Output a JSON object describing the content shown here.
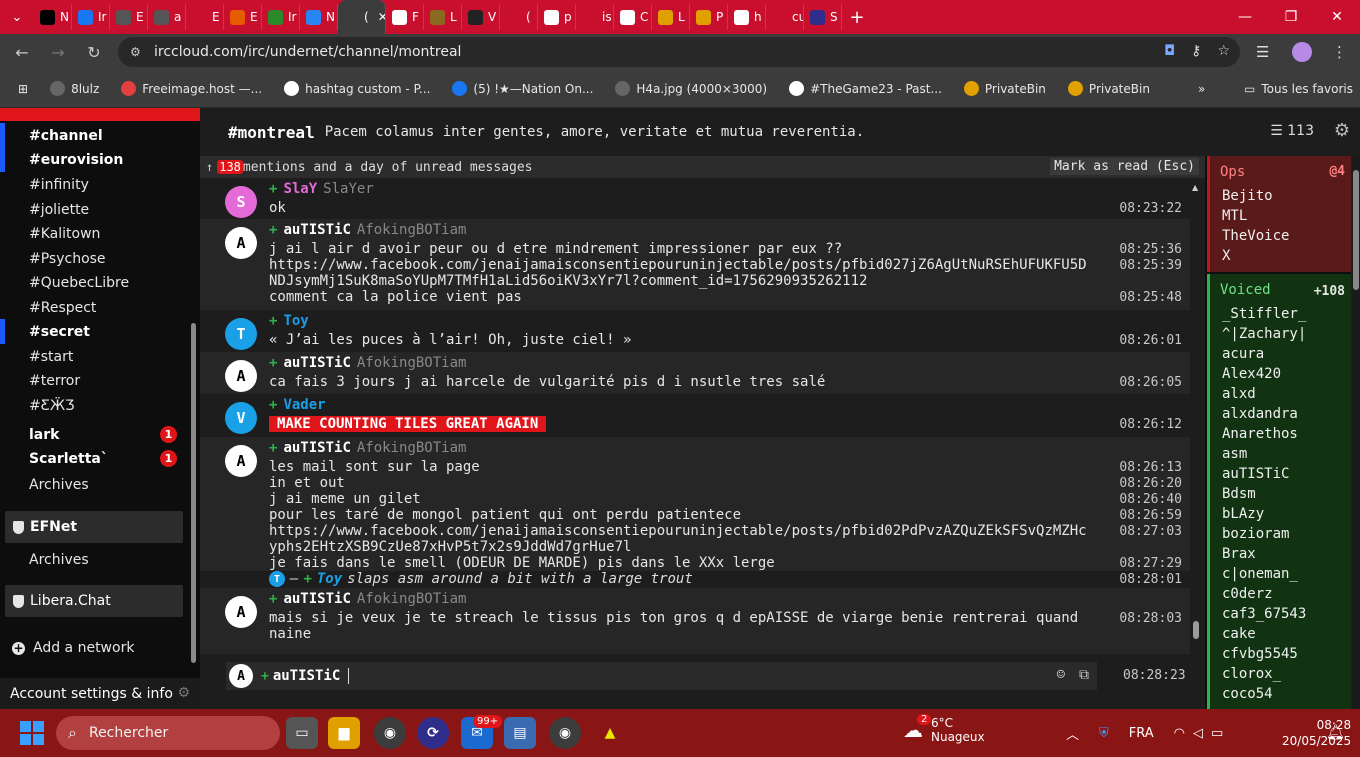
{
  "browser": {
    "tabs": [
      {
        "icon": "x",
        "label": "N",
        "color": "#000000"
      },
      {
        "icon": "f",
        "label": "Ir",
        "color": "#1877f2"
      },
      {
        "icon": "globe",
        "label": "E",
        "color": "#555555"
      },
      {
        "icon": "globe",
        "label": "a",
        "color": "#555555"
      },
      {
        "icon": "spider",
        "label": "E",
        "color": "#c8102e"
      },
      {
        "icon": "gear",
        "label": "E",
        "color": "#e65c00"
      },
      {
        "icon": "earth",
        "label": "Ir",
        "color": "#2a8a2a"
      },
      {
        "icon": "vk",
        "label": "N",
        "color": "#2787f5"
      },
      {
        "icon": "irccloud",
        "label": "(",
        "color": "#3c3c3c"
      },
      {
        "icon": "f",
        "label": "F",
        "color": "#ffffff"
      },
      {
        "icon": "pic",
        "label": "L",
        "color": "#8a6a20"
      },
      {
        "icon": "eyes",
        "label": "V",
        "color": "#222222"
      },
      {
        "icon": "leaf",
        "label": "(",
        "color": "#c8102e"
      },
      {
        "icon": "grid",
        "label": "p",
        "color": "#ffffff"
      },
      {
        "icon": "is",
        "label": "is",
        "color": "#c8102e"
      },
      {
        "icon": "io",
        "label": "C",
        "color": "#ffffff"
      },
      {
        "icon": "hat",
        "label": "L",
        "color": "#e0a000"
      },
      {
        "icon": "hex",
        "label": "P",
        "color": "#e0a000"
      },
      {
        "icon": "grid",
        "label": "h",
        "color": "#ffffff"
      },
      {
        "icon": "cu",
        "label": "cu",
        "color": "#c8102e"
      },
      {
        "icon": "s",
        "label": "S",
        "color": "#2e2e8a"
      }
    ],
    "tab_close": "✕",
    "new_tab": "+",
    "url": "irccloud.com/irc/undernet/channel/montreal",
    "bookmarks": [
      {
        "label": "8lulz",
        "color": "#666666"
      },
      {
        "label": "Freeimage.host —...",
        "color": "#e04040"
      },
      {
        "label": "hashtag custom - P...",
        "color": "#ffffff"
      },
      {
        "label": "(5) !★—Nation On...",
        "color": "#1877f2"
      },
      {
        "label": "H4a.jpg (4000×3000)",
        "color": "#666666"
      },
      {
        "label": "#TheGame23 - Past...",
        "color": "#ffffff"
      },
      {
        "label": "PrivateBin",
        "color": "#e0a000"
      },
      {
        "label": "PrivateBin",
        "color": "#e0a000"
      }
    ],
    "all_bookmarks": "Tous les favoris"
  },
  "sidebar": {
    "channels": [
      {
        "name": "#channel",
        "bold": true,
        "unread": false,
        "badge": ""
      },
      {
        "name": "#eurovision",
        "bold": true,
        "unread": false,
        "badge": ""
      },
      {
        "name": "#infinity",
        "bold": false,
        "unread": false,
        "badge": ""
      },
      {
        "name": "#joliette",
        "bold": false,
        "unread": false,
        "badge": ""
      },
      {
        "name": "#Kalitown",
        "bold": false,
        "unread": false,
        "badge": ""
      },
      {
        "name": "#Psychose",
        "bold": false,
        "unread": false,
        "badge": ""
      },
      {
        "name": "#QuebecLibre",
        "bold": false,
        "unread": false,
        "badge": ""
      },
      {
        "name": "#Respect",
        "bold": false,
        "unread": false,
        "badge": ""
      },
      {
        "name": "#secret",
        "bold": true,
        "unread": true,
        "badge": ""
      },
      {
        "name": "#start",
        "bold": false,
        "unread": false,
        "badge": ""
      },
      {
        "name": "#terror",
        "bold": false,
        "unread": false,
        "badge": ""
      },
      {
        "name": "#ƸӜƷ",
        "bold": false,
        "unread": false,
        "badge": ""
      },
      {
        "name": "lark",
        "bold": true,
        "unread": false,
        "badge": "1"
      },
      {
        "name": "Scarletta`",
        "bold": true,
        "unread": false,
        "badge": "1"
      },
      {
        "name": "Archives",
        "bold": false,
        "unread": false,
        "badge": ""
      }
    ],
    "networks": [
      "EFNet",
      "Libera.Chat"
    ],
    "efnet_archives": "Archives",
    "add_network": "Add a network",
    "account": "Account settings & info"
  },
  "header": {
    "channel": "#montreal",
    "topic": "Pacem colamus inter gentes, amore, veritate et mutua reverentia.",
    "member_count": "113"
  },
  "unread": {
    "count": "138",
    "text": "mentions and a day of unread messages",
    "mark_read": "Mark as read (Esc)"
  },
  "messages": [
    {
      "nick": "SlaY",
      "realname": "SlaYer",
      "avatar": "S",
      "avatar_color": "#e46ad8",
      "nick_color": "#e46ad8",
      "alt": false,
      "lines": [
        {
          "text": "ok",
          "time": "08:23:22"
        }
      ]
    },
    {
      "nick": "auTISTiC",
      "realname": "AfokingBOTiam",
      "avatar": "A",
      "avatar_color": "#ffffff",
      "nick_color": "#ffffff",
      "alt": true,
      "lines": [
        {
          "text": "j ai l air d avoir peur ou d etre mindrement impressioner par eux ??",
          "time": "08:25:36"
        },
        {
          "text": "https://www.facebook.com/jenaijamaisconsentiepouruninjectable/posts/pfbid027jZ6AgUtNuRSEhUFUKFU5D",
          "time": "08:25:39"
        },
        {
          "text": "NDJsymMj1SuK8maSoYUpM7TMfH1aLid56oiKV3xYr7l?comment_id=1756290935262112",
          "time": ""
        },
        {
          "text": "comment ca la police vient pas",
          "time": "08:25:48"
        }
      ]
    },
    {
      "nick": "Toy",
      "realname": "",
      "avatar": "T",
      "avatar_color": "#1aa0e6",
      "nick_color": "#1aa0e6",
      "alt": false,
      "lines": [
        {
          "text": "« J’ai les puces à l’air! Oh, juste ciel! »",
          "time": "08:26:01"
        }
      ]
    },
    {
      "nick": "auTISTiC",
      "realname": "AfokingBOTiam",
      "avatar": "A",
      "avatar_color": "#ffffff",
      "nick_color": "#ffffff",
      "alt": true,
      "lines": [
        {
          "text": "ca fais 3 jours j ai harcele de vulgarité pis d i nsutle tres salé",
          "time": "08:26:05"
        }
      ]
    },
    {
      "nick": "Vader",
      "realname": "",
      "avatar": "V",
      "avatar_color": "#1aa0e6",
      "nick_color": "#1aa0e6",
      "alt": false,
      "lines": [
        {
          "text": "MAKE COUNTING TILES GREAT AGAIN",
          "time": "08:26:12",
          "highlight": true
        }
      ]
    },
    {
      "nick": "auTISTiC",
      "realname": "AfokingBOTiam",
      "avatar": "A",
      "avatar_color": "#ffffff",
      "nick_color": "#ffffff",
      "alt": true,
      "lines": [
        {
          "text": "les mail sont sur la page",
          "time": "08:26:13"
        },
        {
          "text": "in et out",
          "time": "08:26:20"
        },
        {
          "text": "j ai meme un gilet",
          "time": "08:26:40"
        },
        {
          "text": "pour les taré de mongol patient qui ont perdu patientece",
          "time": "08:26:59"
        },
        {
          "text": "https://www.facebook.com/jenaijamaisconsentiepouruninjectable/posts/pfbid02PdPvzAZQuZEkSFSvQzMZHc",
          "time": "08:27:03"
        },
        {
          "text": "yphs2EHtzXSB9CzUe87xHvP5t7x2s9JddWd7grHue7l",
          "time": ""
        },
        {
          "text": "je fais dans le smell (ODEUR DE MARDE) pis dans le XXx lerge",
          "time": "08:27:29"
        }
      ]
    },
    {
      "action": true,
      "nick": "Toy",
      "text": "slaps asm around a bit with a large trout",
      "time": "08:28:01",
      "avatar": "T"
    },
    {
      "nick": "auTISTiC",
      "realname": "AfokingBOTiam",
      "avatar": "A",
      "avatar_color": "#ffffff",
      "nick_color": "#ffffff",
      "alt": true,
      "lines": [
        {
          "text": "mais si je veux je te streach le tissus pis ton gros q d epAISSE de viarge benie rentrerai quand",
          "time": "08:28:03"
        },
        {
          "text": "naine",
          "time": ""
        }
      ]
    }
  ],
  "input": {
    "avatar": "A",
    "nick": "auTISTiC",
    "time": "08:28:23"
  },
  "userlist": {
    "ops_label": "Ops",
    "ops_count": "@4",
    "ops": [
      "Bejito",
      "MTL",
      "TheVoice",
      "X"
    ],
    "voiced_label": "Voiced",
    "voiced_count": "+108",
    "voiced": [
      "_Stiffler_",
      "^|Zachary|",
      "acura",
      "Alex420",
      "alxd",
      "alxdandra",
      "Anarethos",
      "asm",
      "auTISTiC",
      "Bdsm",
      "bLAzy",
      "bozioram",
      "Brax",
      "c|oneman_",
      "c0derz",
      "caf3_67543",
      "cake",
      "cfvbg5545",
      "clorox_",
      "coco54"
    ]
  },
  "taskbar": {
    "search_placeholder": "Rechercher",
    "badge_99": "99+",
    "weather_badge": "2",
    "temperature": "6°C",
    "weather_desc": "Nuageux",
    "language": "FRA",
    "time": "08:28",
    "date": "20/05/2025"
  }
}
